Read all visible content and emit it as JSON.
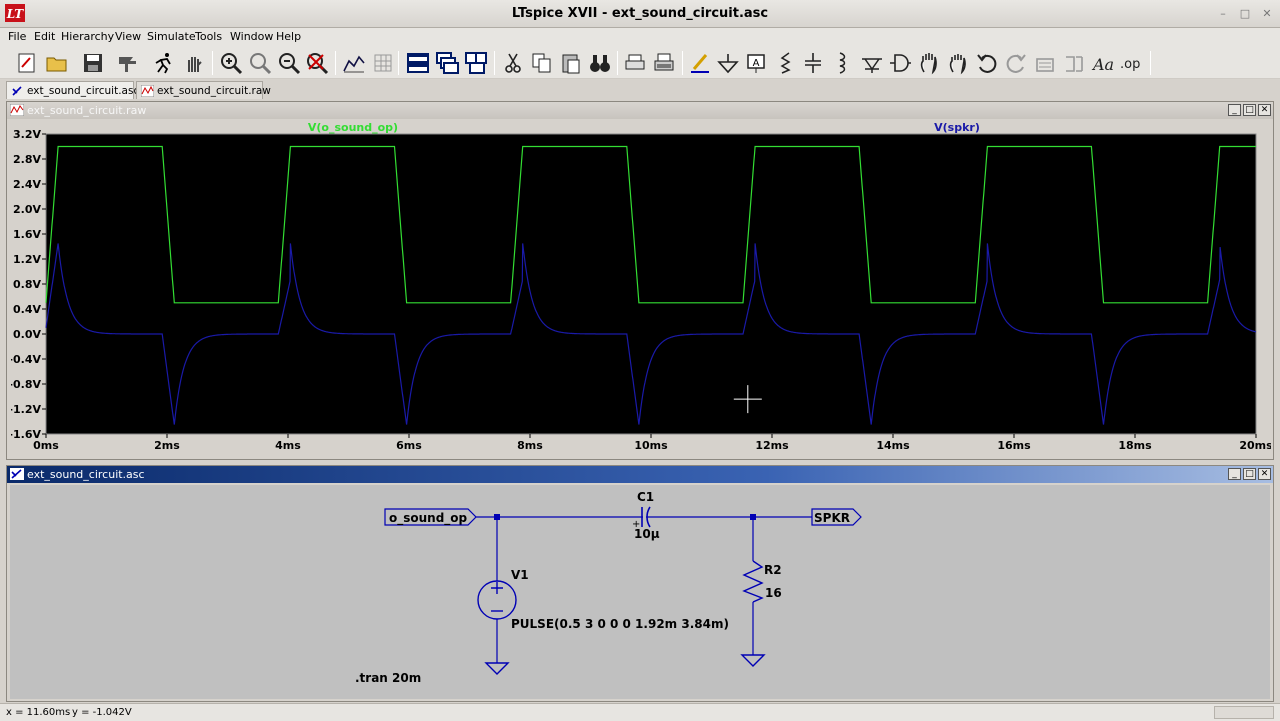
{
  "window": {
    "title": "LTspice XVII - ext_sound_circuit.asc",
    "minimize": "–",
    "maximize": "□",
    "close": "✕"
  },
  "menu": [
    "File",
    "Edit",
    "Hierarchy",
    "View",
    "Simulate",
    "Tools",
    "Window",
    "Help"
  ],
  "toolbar_icons": [
    "new-schematic-icon",
    "open-icon",
    "save-icon",
    "control-panel-icon",
    "run-icon",
    "halt-icon",
    "zoom-in-icon",
    "zoom-pan-icon",
    "zoom-out-icon",
    "zoom-fit-icon",
    "autorange-icon",
    "grid-icon",
    "tile-horizontal-icon",
    "cascade-icon",
    "tile-vertical-icon",
    "cut-icon",
    "copy-icon",
    "paste-icon",
    "find-icon",
    "print-setup-icon",
    "print-icon",
    "draw-wire-icon",
    "ground-icon",
    "label-net-icon",
    "resistor-icon",
    "capacitor-icon",
    "inductor-icon",
    "diode-icon",
    "component-icon",
    "move-icon",
    "drag-icon",
    "undo-icon",
    "redo-icon",
    "rotate-icon",
    "mirror-icon",
    "text-icon",
    "spice-directive-icon"
  ],
  "tabs": [
    {
      "label": "ext_sound_circuit.asc",
      "active": true
    },
    {
      "label": "ext_sound_circuit.raw",
      "active": false
    }
  ],
  "waveform_window": {
    "title": "ext_sound_circuit.raw"
  },
  "schematic_window": {
    "title": "ext_sound_circuit.asc",
    "labels": {
      "net_in": "o_sound_op",
      "net_out": "SPKR",
      "c1_name": "C1",
      "c1_value": "10µ",
      "v1_name": "V1",
      "v1_value": "PULSE(0.5 3 0 0 0 1.92m 3.84m)",
      "r2_name": "R2",
      "r2_value": "16",
      "directive": ".tran 20m"
    }
  },
  "status": {
    "x": "x = 11.60ms",
    "y": "y = -1.042V"
  },
  "colors": {
    "plot_bg": "#000000",
    "trace_green": "#33dd33",
    "trace_blue": "#1a1aa8",
    "wire": "#0000b4",
    "schematic_bg": "#c0c0c0"
  },
  "chart_data": {
    "type": "line",
    "title": "",
    "xlabel": "",
    "ylabel": "",
    "xlim": [
      0,
      20
    ],
    "ylim": [
      -1.6,
      3.2
    ],
    "x_ticks": [
      "0ms",
      "2ms",
      "4ms",
      "6ms",
      "8ms",
      "10ms",
      "12ms",
      "14ms",
      "16ms",
      "18ms",
      "20ms"
    ],
    "y_ticks": [
      "3.2V",
      "2.8V",
      "2.4V",
      "2.0V",
      "1.6V",
      "1.2V",
      "0.8V",
      "0.4V",
      "0.0V",
      "-0.4V",
      "-0.8V",
      "-1.2V",
      "-1.6V"
    ],
    "grid": false,
    "series": [
      {
        "name": "V(o_sound_op)",
        "kind": "pulse",
        "low": 0.5,
        "high": 3.0,
        "period_ms": 3.84,
        "on_ms": 1.92,
        "edge_ms": 0.2
      },
      {
        "name": "V(spkr)",
        "kind": "rc_response",
        "peak": 1.45,
        "trough": -1.45,
        "tau_ms": 0.16,
        "period_ms": 3.84,
        "on_ms": 1.92,
        "edge_ms": 0.2
      }
    ],
    "cursor": {
      "x_ms": 11.6,
      "y_v": -1.042
    }
  }
}
